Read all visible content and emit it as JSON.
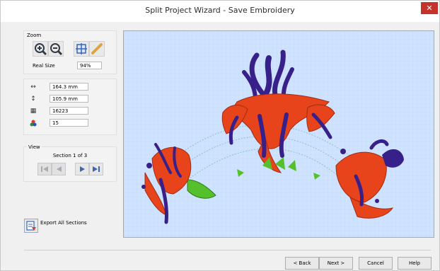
{
  "window": {
    "title": "Split Project Wizard - Save Embroidery",
    "close_glyph": "✕"
  },
  "zoom": {
    "label": "Zoom",
    "tools": [
      "zoom-in-icon",
      "zoom-out-icon",
      "fit-icon",
      "measure-icon"
    ],
    "real_size_label": "Real Size",
    "real_size_value": "94%"
  },
  "info": {
    "width": "164.3 mm",
    "height": "105.9 mm",
    "stitches": "16223",
    "colors": "15"
  },
  "view": {
    "label": "View",
    "section_text": "Section 1 of 3"
  },
  "export": {
    "label": "Export All Sections"
  },
  "buttons": {
    "back": "< Back",
    "next": "Next >",
    "cancel": "Cancel",
    "help": "Help"
  },
  "colors": {
    "accent": "#3b66b0",
    "canvas_bg": "#cfe3ff",
    "petal": "#e8441c",
    "purple": "#38208a",
    "leaf": "#54c02b"
  }
}
